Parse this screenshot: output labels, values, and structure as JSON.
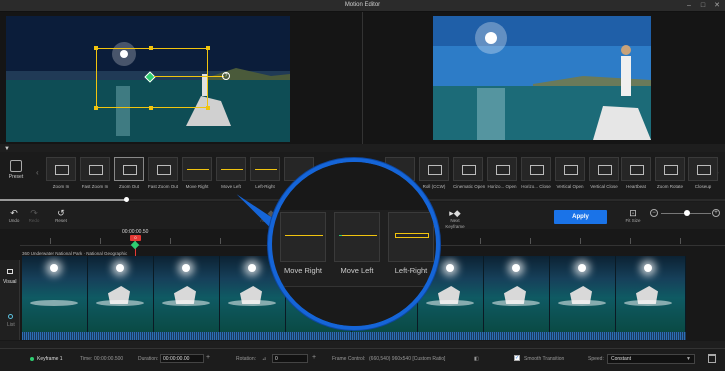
{
  "window": {
    "title": "Motion Editor"
  },
  "presets": {
    "label": "Preset",
    "items": [
      "Zoom In",
      "Fast Zoom In",
      "Zoom Out",
      "Fast Zoom Out",
      "Move Right",
      "Move Left",
      "Left-Right",
      "",
      "",
      "",
      "Roll (CCW)",
      "Cinematic Open",
      "Horizo... Open",
      "Horizo... Close",
      "Vertical Open",
      "Vertical Close",
      "Heartbeat",
      "Zoom Rotate",
      "Closeup"
    ]
  },
  "magnifier": {
    "items": [
      "Move Right",
      "Move Left",
      "Left-Right"
    ]
  },
  "toolbar": {
    "undo": "Undo",
    "redo": "Redo",
    "reset": "Reset",
    "add_keyframe_partial": "Add Keyf...",
    "frame_partial": "frame",
    "next_keyframe": "Next Keyframe",
    "apply": "Apply",
    "fit_size": "Fit Size"
  },
  "timeline": {
    "timecode": "00:00:00.50",
    "playhead_label": "0",
    "clip_label": "360 Underwater National Park · National Geographic",
    "side_visual": "Visual",
    "side_list": "List"
  },
  "status": {
    "keyframe": "Keyframe 1",
    "time_label": "Time:",
    "time_value": "00:00:00.500",
    "duration_label": "Duration:",
    "duration_value": "00:00:00.00",
    "rotation_label": "Rotation:",
    "rotation_value": "0",
    "frame_control_label": "Frame Control:",
    "frame_control_value": "(660,540)  960x540  [Custom Ratio]",
    "smooth_transition": "Smooth Transition",
    "speed_label": "Speed:",
    "speed_value": "Constant"
  },
  "colors": {
    "accent": "#1a73e8",
    "playhead": "#e53935",
    "keyframe": "#2ecc71",
    "crop": "#f1c40f"
  }
}
